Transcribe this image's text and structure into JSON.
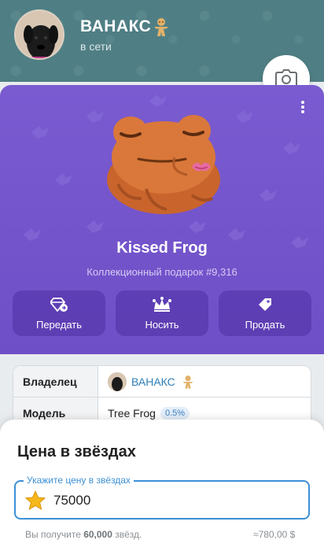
{
  "header": {
    "name": "ВАНАКС",
    "status": "в сети"
  },
  "gift": {
    "title": "Kissed Frog",
    "subtitle": "Коллекционный подарок #9,316",
    "actions": [
      {
        "label": "Передать",
        "icon": "gem-send-icon"
      },
      {
        "label": "Носить",
        "icon": "crown-icon"
      },
      {
        "label": "Продать",
        "icon": "price-tag-icon"
      }
    ]
  },
  "info": {
    "owner_key": "Владелец",
    "owner_value": "ВАНАКС",
    "model_key": "Модель",
    "model_value": "Tree Frog",
    "model_percent": "0.5%"
  },
  "sheet": {
    "title": "Цена в звёздах",
    "field_label": "Укажите цену в звёздах",
    "field_value": "75000",
    "hint_prefix": "Вы получите ",
    "hint_amount": "60,000",
    "hint_suffix": " звёзд.",
    "hint_usd": "≈780,00 $"
  },
  "colors": {
    "header_bg": "#4f7f85",
    "card_bg": "#7a5bd0",
    "accent": "#3c90d6"
  }
}
